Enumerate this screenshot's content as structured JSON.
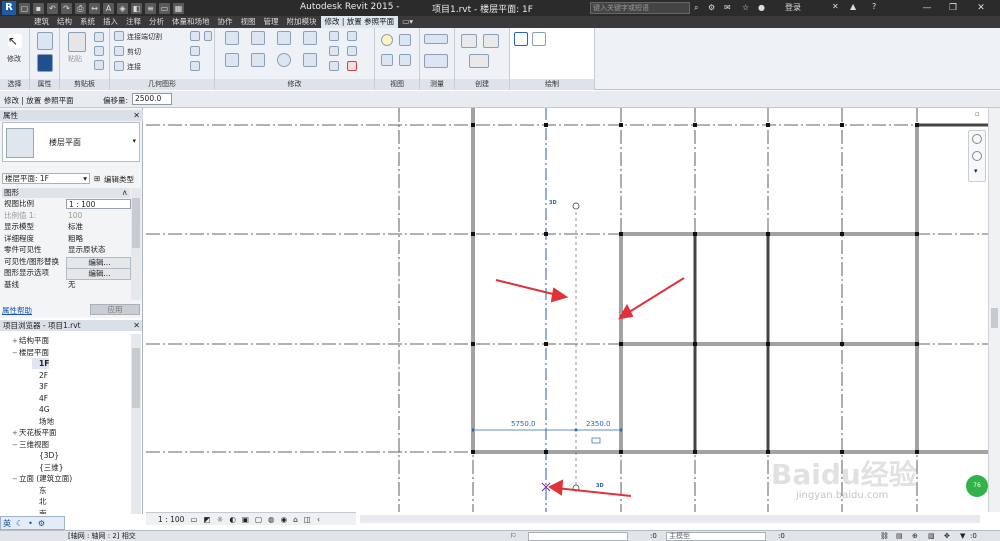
{
  "titlebar": {
    "app_title": "Autodesk Revit 2015 -",
    "doc_title": "项目1.rvt - 楼层平面: 1F",
    "search_placeholder": "键入关键字或短语",
    "login_label": "登录",
    "help_label": "?"
  },
  "ribbon_tabs": [
    "建筑",
    "结构",
    "系统",
    "插入",
    "注释",
    "分析",
    "体量和场地",
    "协作",
    "视图",
    "管理",
    "附加模块",
    "修改 | 放置 参照平面"
  ],
  "ribbon": {
    "modify_label": "修改",
    "paste_label": "粘贴",
    "join_label": "连接端切割",
    "cut_label": "剪切",
    "connect_label": "连接",
    "panels": [
      "选择",
      "属性",
      "剪贴板",
      "几何图形",
      "修改",
      "视图",
      "测量",
      "创建",
      "绘制"
    ]
  },
  "options_bar": {
    "context": "修改 | 放置 参照平面",
    "offset_label": "偏移量:",
    "offset_value": "2500.0"
  },
  "properties": {
    "title": "属性",
    "type_name": "楼层平面",
    "instance_selector": "楼层平面: 1F",
    "edit_type": "编辑类型",
    "section": "图形",
    "rows": [
      {
        "key": "视图比例",
        "value": "1 : 100",
        "kind": "box"
      },
      {
        "key": "比例值 1:",
        "value": "100",
        "kind": "dim"
      },
      {
        "key": "显示模型",
        "value": "标准",
        "kind": "text"
      },
      {
        "key": "详细程度",
        "value": "粗略",
        "kind": "text"
      },
      {
        "key": "零件可见性",
        "value": "显示原状态",
        "kind": "text"
      },
      {
        "key": "可见性/图形替换",
        "value": "编辑...",
        "kind": "btn"
      },
      {
        "key": "图形显示选项",
        "value": "编辑...",
        "kind": "btn"
      },
      {
        "key": "基线",
        "value": "无",
        "kind": "text"
      }
    ],
    "help_link": "属性帮助",
    "apply_label": "应用"
  },
  "browser": {
    "title": "项目浏览器 - 项目1.rvt",
    "items": [
      {
        "label": "结构平面",
        "indent": 0,
        "exp": "+"
      },
      {
        "label": "楼层平面",
        "indent": 0,
        "exp": "−"
      },
      {
        "label": "1F",
        "indent": 1,
        "exp": "",
        "selected": true
      },
      {
        "label": "2F",
        "indent": 1,
        "exp": ""
      },
      {
        "label": "3F",
        "indent": 1,
        "exp": ""
      },
      {
        "label": "4F",
        "indent": 1,
        "exp": ""
      },
      {
        "label": "4G",
        "indent": 1,
        "exp": ""
      },
      {
        "label": "场地",
        "indent": 1,
        "exp": ""
      },
      {
        "label": "天花板平面",
        "indent": 0,
        "exp": "+"
      },
      {
        "label": "三维视图",
        "indent": 0,
        "exp": "−"
      },
      {
        "label": "{3D}",
        "indent": 1,
        "exp": ""
      },
      {
        "label": "{三维}",
        "indent": 1,
        "exp": ""
      },
      {
        "label": "立面 (建筑立面)",
        "indent": 0,
        "exp": "−"
      },
      {
        "label": "东",
        "indent": 1,
        "exp": ""
      },
      {
        "label": "北",
        "indent": 1,
        "exp": ""
      },
      {
        "label": "南",
        "indent": 1,
        "exp": ""
      }
    ]
  },
  "canvas": {
    "dim_left": "5750.0",
    "dim_right": "2350.0",
    "tag_3d_a": "3D",
    "tag_3d_b": "3D",
    "watermark": "Baidu经验",
    "watermark_url": "jingyan.baidu.com"
  },
  "view_control": {
    "scale": "1 : 100"
  },
  "ime": {
    "lang": "英"
  },
  "status": {
    "text": "[轴网 : 轴网 : 2] 相交",
    "coord_a": ":0",
    "coord_b": ":0",
    "model": "主模型",
    "coord_c": ":0"
  }
}
